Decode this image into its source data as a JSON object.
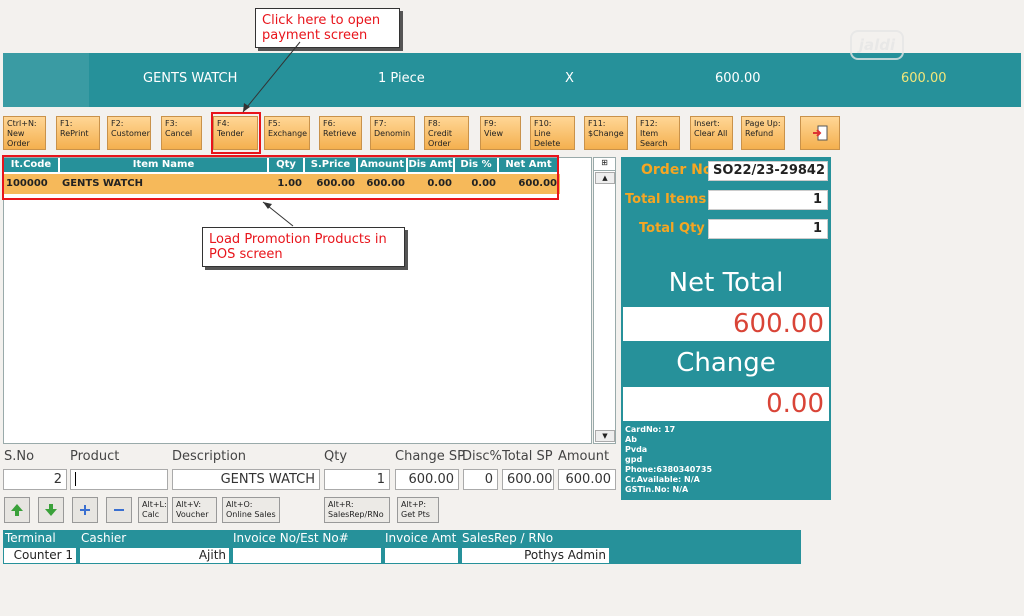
{
  "annotations": {
    "tender_callout": "Click here to open payment screen",
    "promo_callout": "Load Promotion Products in POS screen"
  },
  "header": {
    "item": "GENTS WATCH",
    "qty": "1 Piece",
    "x": "X",
    "price": "600.00",
    "total": "600.00",
    "watermark": "jaldi"
  },
  "toolbar": [
    {
      "label": "Ctrl+N:\nNew\nOrder"
    },
    {
      "label": "F1:\nRePrint"
    },
    {
      "label": "F2:\nCustomer"
    },
    {
      "label": "F3:\nCancel"
    },
    {
      "label": "F4:\nTender"
    },
    {
      "label": "F5:\nExchange"
    },
    {
      "label": "F6:\nRetrieve"
    },
    {
      "label": "F7:\nDenomin"
    },
    {
      "label": "F8:\nCredit\nOrder"
    },
    {
      "label": "F9:\nView"
    },
    {
      "label": "F10:\nLine\nDelete"
    },
    {
      "label": "F11:\n$Change"
    },
    {
      "label": "F12:\nItem\nSearch"
    },
    {
      "label": "Insert:\nClear All"
    },
    {
      "label": "Page Up:\nRefund"
    }
  ],
  "grid": {
    "columns": [
      "It.Code",
      "Item Name",
      "Qty",
      "S.Price",
      "Amount",
      "Dis Amt",
      "Dis %",
      "Net Amt"
    ],
    "rows": [
      [
        "100000",
        "GENTS WATCH",
        "1.00",
        "600.00",
        "600.00",
        "0.00",
        "0.00",
        "600.00"
      ]
    ]
  },
  "summary": {
    "order_no_label": "Order No",
    "order_no": "SO22/23-29842",
    "total_items_label": "Total Items",
    "total_items": "1",
    "total_qty_label": "Total Qty",
    "total_qty": "1",
    "net_total_label": "Net Total",
    "net_total": "600.00",
    "change_label": "Change",
    "change": "0.00",
    "customer_info": [
      "CardNo: 17",
      "Ab",
      "Pvda",
      "gpd",
      "Phone:6380340735",
      "Cr.Available: N/A",
      "GSTin.No: N/A"
    ]
  },
  "entry": {
    "labels": {
      "sno": "S.No",
      "product": "Product",
      "description": "Description",
      "qty": "Qty",
      "change_sp": "Change SP",
      "disc": "Disc%",
      "total_sp": "Total SP",
      "amount": "Amount"
    },
    "values": {
      "sno": "2",
      "product": "",
      "description": "GENTS WATCH",
      "qty": "1",
      "change_sp": "600.00",
      "disc": "0",
      "total_sp": "600.00",
      "amount": "600.00"
    }
  },
  "shortcuts": [
    {
      "label": "Alt+L:\nCalc"
    },
    {
      "label": "Alt+V:\nVoucher"
    },
    {
      "label": "Alt+O:\nOnline Sales"
    },
    {
      "label": "Alt+R:\nSalesRep/RNo"
    },
    {
      "label": "Alt+P:\nGet Pts"
    }
  ],
  "status": {
    "terminal_label": "Terminal",
    "cashier_label": "Cashier",
    "invoice_label": "Invoice No/Est No#",
    "invoice_amt_label": "Invoice Amt",
    "salesrep_label": "SalesRep / RNo",
    "terminal": "Counter 1",
    "cashier": "Ajith",
    "invoice": "",
    "invoice_amt": "",
    "salesrep": "Pothys Admin"
  },
  "colors": {
    "teal": "#26919a",
    "orange": "#f4b04f",
    "annotation_red": "#e8141b"
  }
}
